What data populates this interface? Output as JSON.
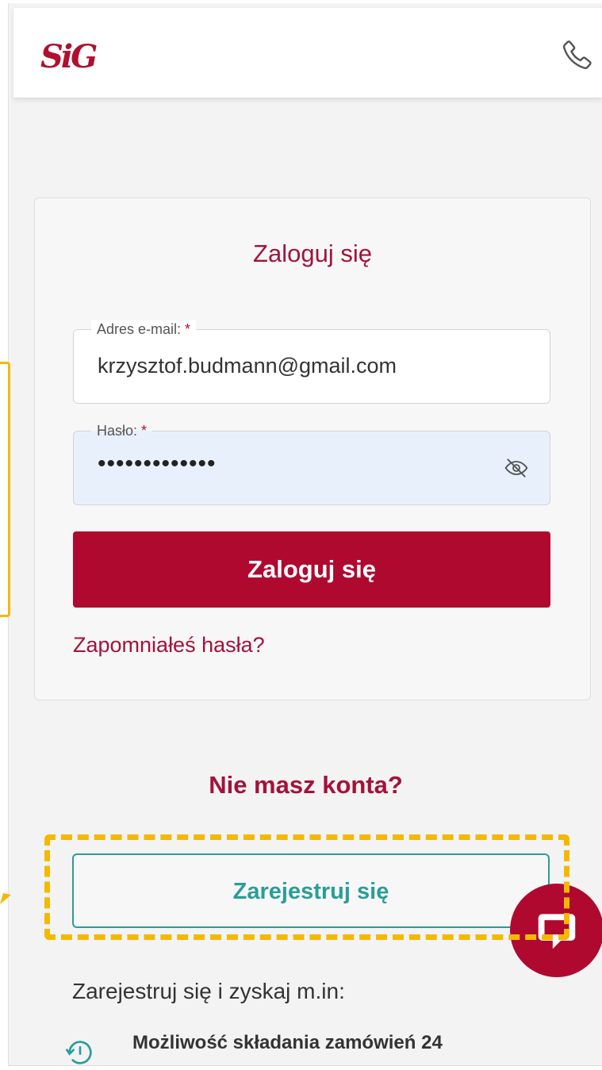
{
  "header": {
    "logo_text": "SiG",
    "phone_icon": "phone-icon",
    "brand_color": "#b0102f"
  },
  "login": {
    "title": "Zaloguj się",
    "email_label": "Adres e-mail:",
    "email_required": "*",
    "email_value": "krzysztof.budmann@gmail.com",
    "password_label": "Hasło:",
    "password_required": "*",
    "password_mask": "•••••••••••••",
    "password_toggle_icon": "eye-slash-icon",
    "submit_label": "Zaloguj się",
    "forgot_label": "Zapomniałeś hasła?"
  },
  "register": {
    "heading": "Nie masz konta?",
    "button_label": "Zarejestruj się",
    "accent_color": "#2a9d97",
    "perks_intro": "Zarejestruj się i zyskaj m.in:",
    "perks": [
      {
        "icon": "history-icon",
        "text": "Możliwość składania zamówień 24"
      }
    ]
  },
  "chat": {
    "icon": "chat-icon"
  },
  "annotation": {
    "highlight_color": "#f5b800"
  }
}
